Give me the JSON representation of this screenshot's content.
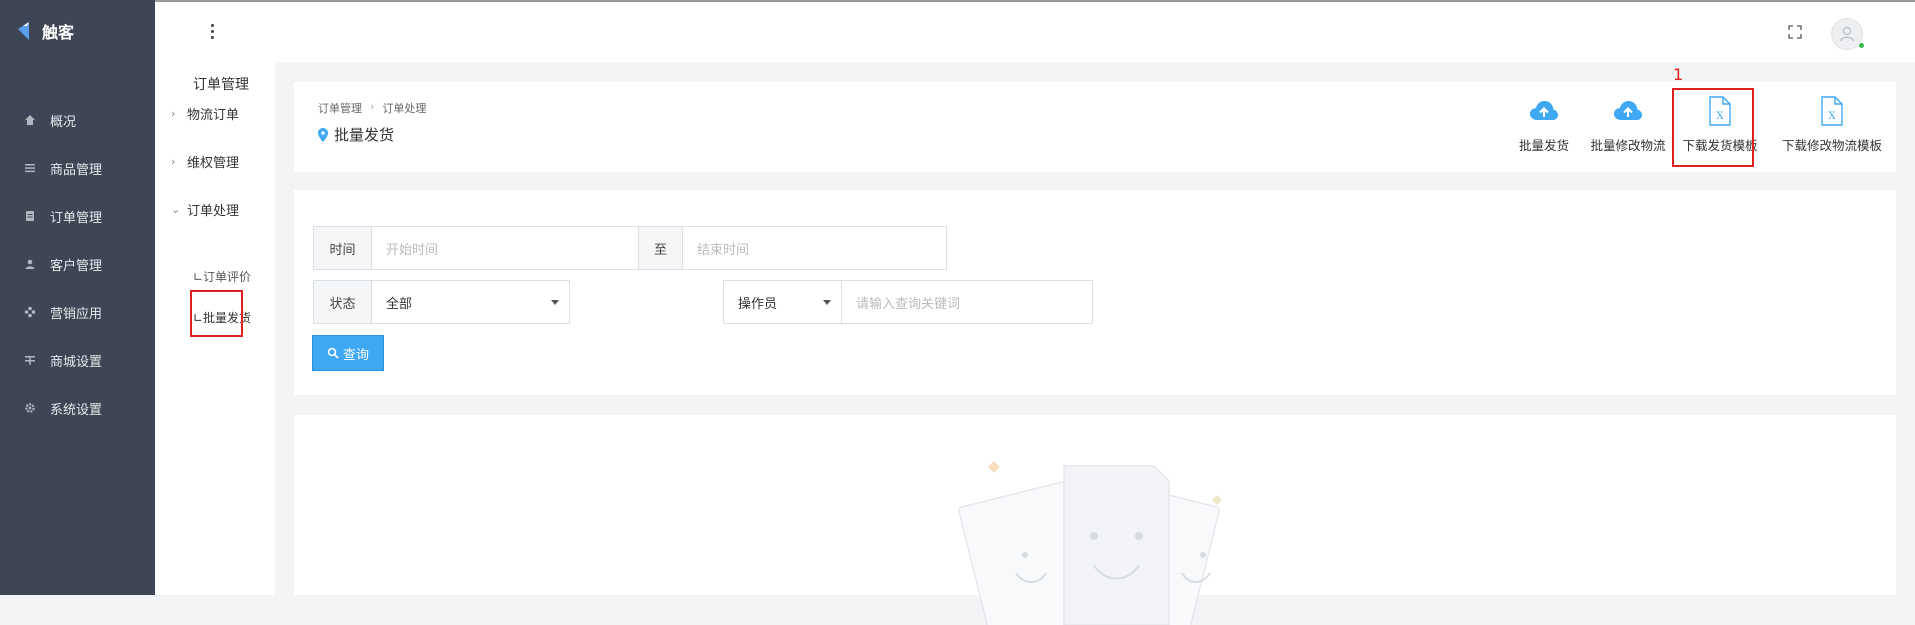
{
  "app": {
    "logo_text": "触客"
  },
  "sidebar": {
    "items": [
      {
        "label": "概况",
        "icon": "home-icon"
      },
      {
        "label": "商品管理",
        "icon": "list-icon"
      },
      {
        "label": "订单管理",
        "icon": "order-icon"
      },
      {
        "label": "客户管理",
        "icon": "user-icon"
      },
      {
        "label": "营销应用",
        "icon": "apps-icon"
      },
      {
        "label": "商城设置",
        "icon": "store-settings-icon"
      },
      {
        "label": "系统设置",
        "icon": "gear-icon"
      }
    ]
  },
  "submenu": {
    "title": "订单管理",
    "groups": [
      {
        "label": "物流订单",
        "expanded": false
      },
      {
        "label": "维权管理",
        "expanded": false
      },
      {
        "label": "订单处理",
        "expanded": true
      }
    ],
    "leaves": [
      {
        "label": "∟订单评价"
      },
      {
        "label": "∟批量发货",
        "active": true
      }
    ]
  },
  "breadcrumb": {
    "level1": "订单管理",
    "level2": "订单处理"
  },
  "page": {
    "title": "批量发货"
  },
  "actions": [
    {
      "label": "批量发货",
      "icon": "cloud-upload-icon"
    },
    {
      "label": "批量修改物流",
      "icon": "cloud-upload-icon"
    },
    {
      "label": "下载发货模板",
      "icon": "excel-file-icon",
      "highlighted": true
    },
    {
      "label": "下载修改物流模板",
      "icon": "excel-file-icon"
    }
  ],
  "annotation": {
    "marker": "1"
  },
  "filters": {
    "time_label": "时间",
    "start_placeholder": "开始时间",
    "to_label": "至",
    "end_placeholder": "结束时间",
    "status_label": "状态",
    "status_value": "全部",
    "operator_label": "操作员",
    "keyword_placeholder": "请输入查询关键词",
    "search_button": "查询"
  },
  "colors": {
    "sidebar_bg": "#3e4555",
    "accent": "#3ea8f5",
    "highlight_red": "#e02020"
  }
}
